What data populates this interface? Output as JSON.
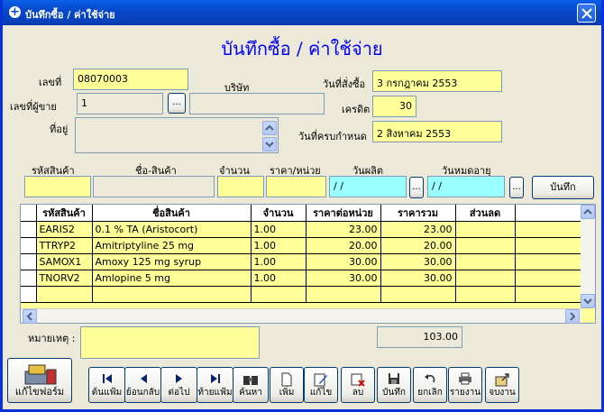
{
  "window": {
    "title": "บันทึกซื้อ / ค่าใช้จ่าย"
  },
  "page_title": "บันทึกซื้อ / ค่าใช้จ่าย",
  "form": {
    "doc_no_label": "เลขที่",
    "doc_no": "08070003",
    "vendor_no_label": "เลขที่ผู้ขาย",
    "vendor_no": "1",
    "company_label": "บริษัท",
    "company": "",
    "address_label": "ที่อยู่",
    "address": "",
    "order_date_label": "วันที่สั่งซื้อ",
    "order_date": "3 กรกฎาคม 2553",
    "credit_label": "เครดิต",
    "credit": "30",
    "due_date_label": "วันที่ครบกำหนด",
    "due_date": "2 สิงหาคม 2553"
  },
  "entry": {
    "code_label": "รหัสสินค้า",
    "name_label": "ชื่อ-สินค้า",
    "qty_label": "จำนวน",
    "price_label": "ราคา/หน่วย",
    "mfg_label": "วันผลิต",
    "exp_label": "วันหมดอายุ",
    "mfg_value": " / /",
    "exp_value": " / /",
    "browse_label": "...",
    "save_label": "บันทึก"
  },
  "table": {
    "columns": [
      "รหัสสินค้า",
      "ชื่อสินค้า",
      "จำนวน",
      "ราคาต่อหน่วย",
      "ราคารวม",
      "ส่วนลด"
    ],
    "rows": [
      [
        "EARIS2",
        "0.1 % TA (Aristocort)",
        "1.00",
        "23.00",
        "23.00",
        ""
      ],
      [
        "TTRYP2",
        "Amitriptyline 25 mg",
        "1.00",
        "20.00",
        "20.00",
        ""
      ],
      [
        "SAMOX1",
        "Amoxy 125 mg syrup",
        "1.00",
        "30.00",
        "30.00",
        ""
      ],
      [
        "TNORV2",
        "Amlopine 5 mg",
        "1.00",
        "30.00",
        "30.00",
        ""
      ]
    ]
  },
  "remark_label": "หมายเหตุ :",
  "remark": "",
  "total": "103.00",
  "buttons": {
    "edit_form": "แก้ไขฟอร์ม",
    "first": "ต้นแฟ้ม",
    "prev": "ย้อนกลับ",
    "next": "ต่อไป",
    "last": "ท้ายแฟ้ม",
    "search": "ค้นหา",
    "add": "เพิ่ม",
    "edit": "แก้ไข",
    "delete": "ลบ",
    "save": "บันทึก",
    "cancel": "ยกเลิก",
    "report": "รายงาน",
    "close": "จบงาน"
  },
  "colors": {
    "title_blue": "#0000FF",
    "field_yellow": "#FFFF99",
    "field_cyan": "#99FFFF",
    "titlebar": "#0747C9"
  }
}
